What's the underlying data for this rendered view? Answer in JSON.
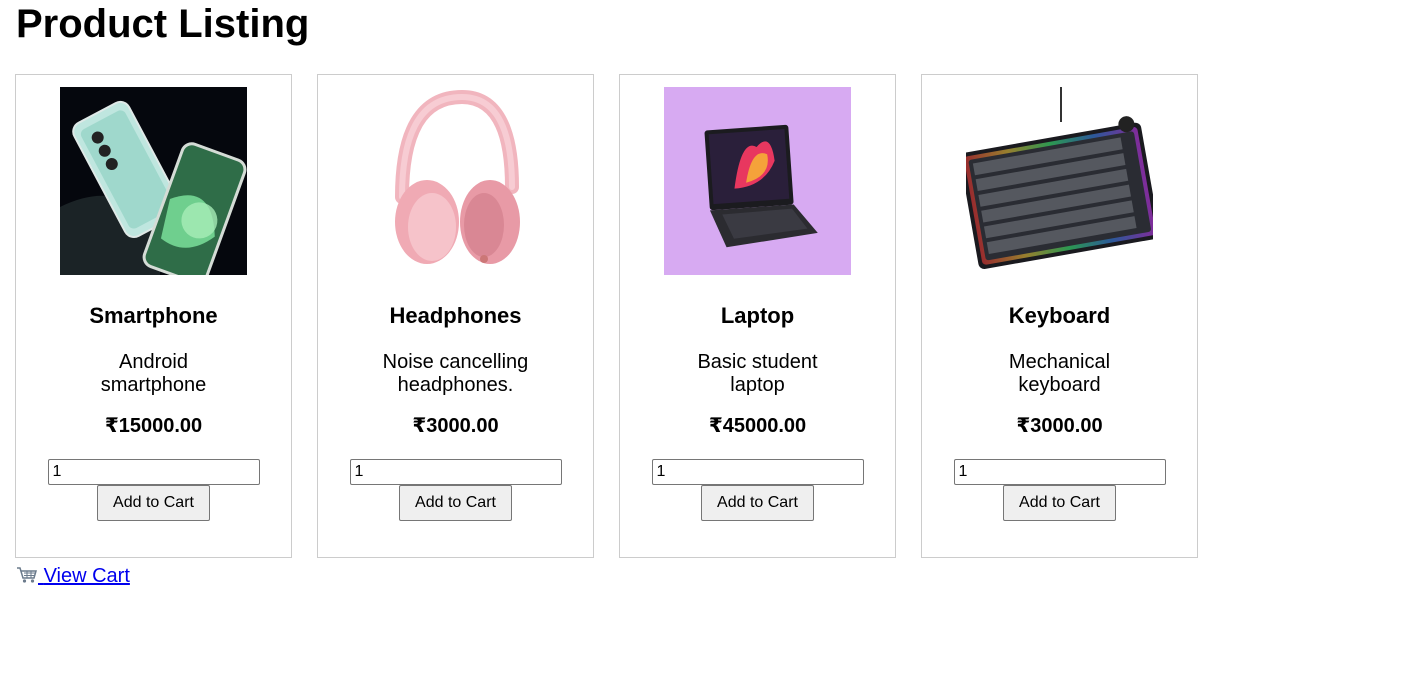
{
  "page": {
    "title": "Product Listing"
  },
  "products": [
    {
      "name": "Smartphone",
      "description": "Android smartphone",
      "price": "₹15000.00",
      "quantity": "1",
      "button_label": "Add to Cart",
      "image_icon": "smartphone-image"
    },
    {
      "name": "Headphones",
      "description": "Noise cancelling headphones.",
      "price": "₹3000.00",
      "quantity": "1",
      "button_label": "Add to Cart",
      "image_icon": "headphones-image"
    },
    {
      "name": "Laptop",
      "description": "Basic student laptop",
      "price": "₹45000.00",
      "quantity": "1",
      "button_label": "Add to Cart",
      "image_icon": "laptop-image"
    },
    {
      "name": "Keyboard",
      "description": "Mechanical keyboard",
      "price": "₹3000.00",
      "quantity": "1",
      "button_label": "Add to Cart",
      "image_icon": "keyboard-image"
    }
  ],
  "footer": {
    "view_cart_label": "View Cart",
    "cart_icon": "shopping-cart-icon"
  },
  "colors": {
    "link": "#0000ee",
    "card_border": "#cccccc",
    "button_bg": "#efefef"
  }
}
